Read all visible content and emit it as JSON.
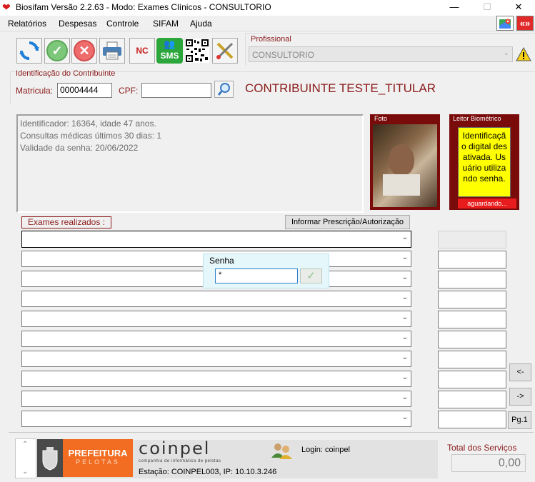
{
  "window": {
    "title": "Biosifam Versão 2.2.63 - Modo: Exames Clínicos - CONSULTORIO",
    "minimize_icon": "minimize-icon",
    "maximize_icon": "maximize-icon",
    "close_icon": "close-icon",
    "app_icon": "heart-icon"
  },
  "menu": {
    "items": [
      "Relatórios",
      "Despesas",
      "Controle",
      "SIFAM",
      "Ajuda"
    ]
  },
  "toolbar": {
    "refresh_icon": "refresh-icon",
    "confirm_icon": "check-icon",
    "cancel_icon": "cancel-icon",
    "print_icon": "printer-icon",
    "nc_label": "NC",
    "sms_label": "SMS",
    "qr_icon": "qr-code-icon",
    "tools_icon": "tools-icon"
  },
  "profissional": {
    "label": "Profissional",
    "value": "CONSULTORIO"
  },
  "contribuinte": {
    "group_label": "Identificação do Contribuinte",
    "matricula_label": "Matricula:",
    "matricula_value": "00004444",
    "cpf_label": "CPF:",
    "cpf_value": "",
    "name": "CONTRIBUINTE TESTE_TITULAR"
  },
  "info": {
    "line1": "Identificador: 16364, idade 47 anos.",
    "line2": "Consultas médicas últimos 30 dias: 1",
    "line3": "Validade da senha: 20/06/2022"
  },
  "foto": {
    "label": "Foto"
  },
  "biometrico": {
    "label": "Leitor Biométrico",
    "message": "Identificação digital desativada. Usuário utilizando senha.",
    "status": "aguardando..."
  },
  "exames": {
    "label": "Exames realizados :",
    "prescricao_button": "Informar Prescrição/Autorização"
  },
  "senha_popup": {
    "title": "Senha",
    "value": "*"
  },
  "nav": {
    "prev": "<-",
    "next": "->",
    "page": "Pg.1"
  },
  "footer": {
    "prefeitura_line1": "PREFEITURA",
    "prefeitura_line2": "PELOTAS",
    "coinpel_name": "coinpel",
    "coinpel_sub": "companhia de informática de pelotas",
    "login": "Login: coinpel",
    "estacao": "Estação: COINPEL003, IP: 10.10.3.246",
    "total_label": "Total dos Serviços",
    "total_value": "0,00"
  },
  "colors": {
    "accent_red": "#8b1a1a",
    "frame_red": "#7a0b0b",
    "biometric_yellow": "#ffff00",
    "prefeitura_orange": "#f26c21"
  }
}
